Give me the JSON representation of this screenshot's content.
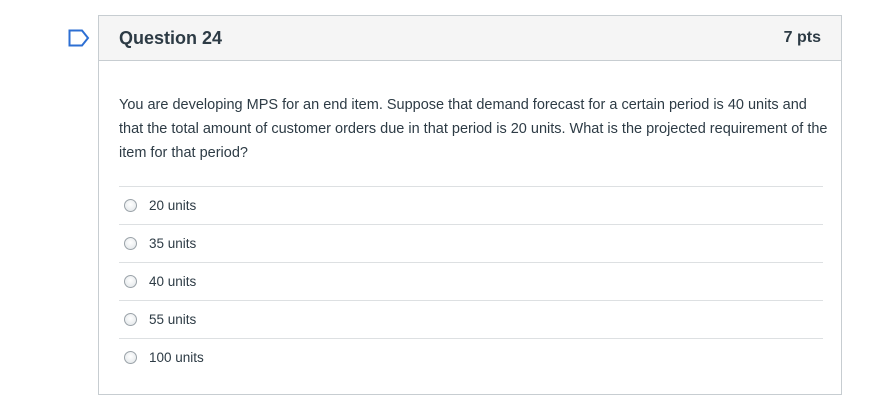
{
  "question": {
    "title": "Question 24",
    "points": "7 pts",
    "text": "You are developing MPS for an end item. Suppose that demand forecast for a certain period is 40 units and that the total amount of customer orders due in that period is 20 units. What is the projected requirement of the item for that period?",
    "flag_icon": "flag-icon"
  },
  "answers": [
    {
      "label": "20 units"
    },
    {
      "label": "35 units"
    },
    {
      "label": "40 units"
    },
    {
      "label": "55 units"
    },
    {
      "label": "100 units"
    }
  ],
  "colors": {
    "flag": "#2d6fd3",
    "header_bg": "#f5f5f5",
    "border": "#c7cdd1",
    "text": "#2d3b45"
  }
}
